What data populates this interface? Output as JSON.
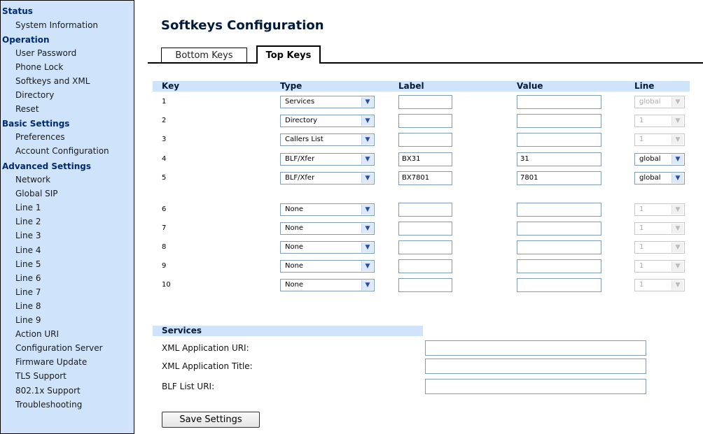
{
  "sidebar": {
    "sections": [
      {
        "label": "Status",
        "items": [
          "System Information"
        ]
      },
      {
        "label": "Operation",
        "items": [
          "User Password",
          "Phone Lock",
          "Softkeys and XML",
          "Directory",
          "Reset"
        ]
      },
      {
        "label": "Basic Settings",
        "items": [
          "Preferences",
          "Account Configuration"
        ]
      },
      {
        "label": "Advanced Settings",
        "items": [
          "Network",
          "Global SIP",
          "Line 1",
          "Line 2",
          "Line 3",
          "Line 4",
          "Line 5",
          "Line 6",
          "Line 7",
          "Line 8",
          "Line 9",
          "Action URI",
          "Configuration Server",
          "Firmware Update",
          "TLS Support",
          "802.1x Support",
          "Troubleshooting"
        ]
      }
    ]
  },
  "page": {
    "title": "Softkeys Configuration"
  },
  "tabs": {
    "bottom": "Bottom Keys",
    "top": "Top Keys"
  },
  "table": {
    "headers": {
      "key": "Key",
      "type": "Type",
      "label": "Label",
      "value": "Value",
      "line": "Line"
    },
    "rows": [
      {
        "key": "1",
        "type": "Services",
        "label": "",
        "value": "",
        "line": "global",
        "line_enabled": false
      },
      {
        "key": "2",
        "type": "Directory",
        "label": "",
        "value": "",
        "line": "1",
        "line_enabled": false
      },
      {
        "key": "3",
        "type": "Callers List",
        "label": "",
        "value": "",
        "line": "1",
        "line_enabled": false
      },
      {
        "key": "4",
        "type": "BLF/Xfer",
        "label": "BX31",
        "value": "31",
        "line": "global",
        "line_enabled": true
      },
      {
        "key": "5",
        "type": "BLF/Xfer",
        "label": "BX7801",
        "value": "7801",
        "line": "global",
        "line_enabled": true
      },
      {
        "key": "6",
        "type": "None",
        "label": "",
        "value": "",
        "line": "1",
        "line_enabled": false
      },
      {
        "key": "7",
        "type": "None",
        "label": "",
        "value": "",
        "line": "1",
        "line_enabled": false
      },
      {
        "key": "8",
        "type": "None",
        "label": "",
        "value": "",
        "line": "1",
        "line_enabled": false
      },
      {
        "key": "9",
        "type": "None",
        "label": "",
        "value": "",
        "line": "1",
        "line_enabled": false
      },
      {
        "key": "10",
        "type": "None",
        "label": "",
        "value": "",
        "line": "1",
        "line_enabled": false
      }
    ]
  },
  "services": {
    "header": "Services",
    "fields": [
      {
        "label": "XML Application URI:",
        "value": ""
      },
      {
        "label": "XML Application Title:",
        "value": ""
      },
      {
        "label": "BLF List URI:",
        "value": ""
      }
    ]
  },
  "save_button": "Save Settings",
  "colors": {
    "sidebar_bg": "#cfe3fb",
    "header_bg": "#cfe3fb",
    "heading_text": "#002a73"
  }
}
